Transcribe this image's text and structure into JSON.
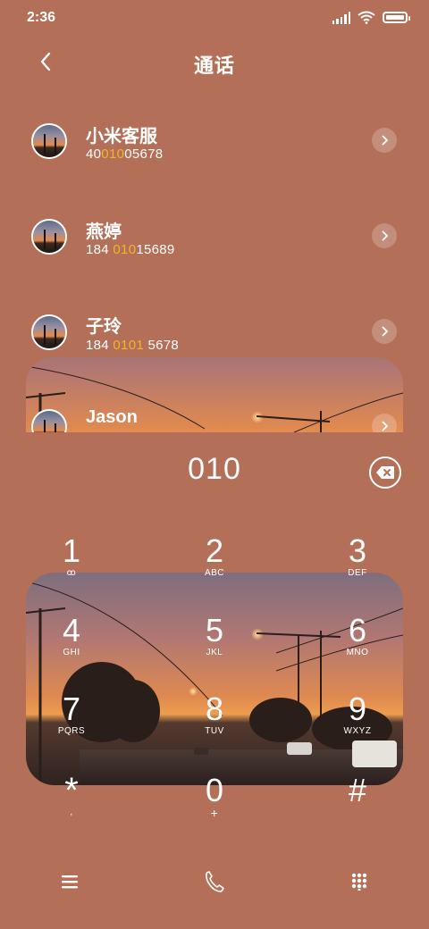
{
  "status_bar": {
    "time": "2:36",
    "battery_percent": 100,
    "icons": [
      "signal-icon",
      "wifi-icon",
      "battery-icon"
    ]
  },
  "header": {
    "title": "通话",
    "back_icon": "chevron-left-icon"
  },
  "contacts": [
    {
      "name": "小米客服",
      "number_pre": "40",
      "number_hl": "010",
      "number_post": "05678"
    },
    {
      "name": "燕婷",
      "number_pre": "184 ",
      "number_hl": "010",
      "number_post": "15689"
    },
    {
      "name": "子玲",
      "number_pre": "184 ",
      "number_hl": "0101",
      "number_post": " 5678"
    },
    {
      "name": "Jason",
      "number_pre": "",
      "number_hl": "",
      "number_post": ""
    }
  ],
  "dialer": {
    "input": "010",
    "keys": [
      {
        "digit": "1",
        "letters": "ꝏ"
      },
      {
        "digit": "2",
        "letters": "ABC"
      },
      {
        "digit": "3",
        "letters": "DEF"
      },
      {
        "digit": "4",
        "letters": "GHI"
      },
      {
        "digit": "5",
        "letters": "JKL"
      },
      {
        "digit": "6",
        "letters": "MNO"
      },
      {
        "digit": "7",
        "letters": "PQRS"
      },
      {
        "digit": "8",
        "letters": "TUV"
      },
      {
        "digit": "9",
        "letters": "WXYZ"
      },
      {
        "digit": "*",
        "letters": ","
      },
      {
        "digit": "0",
        "letters": "+"
      },
      {
        "digit": "#",
        "letters": ""
      }
    ]
  },
  "bottom_nav": [
    "menu-icon",
    "phone-icon",
    "keypad-icon"
  ],
  "colors": {
    "background": "#b36f57",
    "highlight": "#f5b326",
    "text": "#ffffff"
  }
}
